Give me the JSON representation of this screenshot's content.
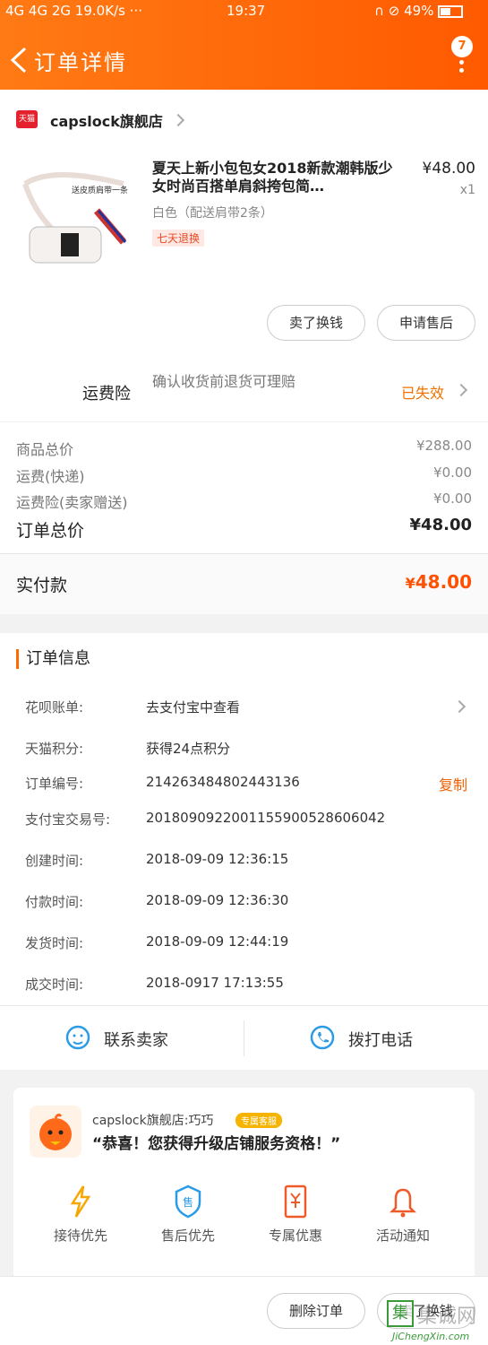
{
  "status_bar": {
    "left": "4G 4G 2G 19.0K/s ···",
    "time": "19:37",
    "battery": "49%"
  },
  "header": {
    "title": "订单详情",
    "badge": "7"
  },
  "shop": {
    "badge_text": "天猫",
    "name": "capslock旗舰店"
  },
  "product": {
    "title": "夏天上新小包包女2018新款潮韩版少女时尚百搭单肩斜挎包简…",
    "price": "¥48.00",
    "qty": "x1",
    "sku": "白色（配送肩带2条）",
    "tag": "七天退换",
    "image_caption": "送皮质肩带一条"
  },
  "actions": {
    "sell_btn": "卖了换钱",
    "after_sale_btn": "申请售后"
  },
  "insurance": {
    "label": "运费险",
    "text": "确认收货前退货可理赔",
    "status": "已失效"
  },
  "fees": [
    {
      "label": "商品总价",
      "value": "¥288.00"
    },
    {
      "label": "运费(快递)",
      "value": "¥0.00"
    },
    {
      "label": "运费险(卖家赠送)",
      "value": "¥0.00"
    }
  ],
  "total": {
    "label": "订单总价",
    "value": "¥48.00"
  },
  "paid": {
    "label": "实付款",
    "currency": "¥",
    "value": "48.00"
  },
  "order_info": {
    "title": "订单信息",
    "rows": [
      {
        "key": "花呗账单:",
        "value": "去支付宝中查看"
      },
      {
        "key": "天猫积分:",
        "value": "获得24点积分"
      },
      {
        "key": "订单编号:",
        "value": "214263484802443136"
      },
      {
        "key": "支付宝交易号:",
        "value": "2018090922001155900528606042"
      },
      {
        "key": "创建时间:",
        "value": "2018-09-09 12:36:15"
      },
      {
        "key": "付款时间:",
        "value": "2018-09-09 12:36:30"
      },
      {
        "key": "发货时间:",
        "value": "2018-09-09 12:44:19"
      },
      {
        "key": "成交时间:",
        "value": "2018-0917 17:13:55"
      }
    ],
    "copy": "复制"
  },
  "contact": {
    "seller": "联系卖家",
    "call": "拨打电话"
  },
  "vip": {
    "shop": "capslock旗舰店:巧巧",
    "tag": "专属客服",
    "message": "“恭喜！您获得升级店铺服务资格！”",
    "items": [
      {
        "label": "接待优先",
        "icon": "lightning-icon"
      },
      {
        "label": "售后优先",
        "icon": "shield-icon"
      },
      {
        "label": "专属优惠",
        "icon": "coupon-icon"
      },
      {
        "label": "活动通知",
        "icon": "bell-icon"
      }
    ]
  },
  "bottom": {
    "delete_btn": "删除订单",
    "sell_btn": "卖了换钱"
  },
  "watermark": {
    "main": "集诚网",
    "url": "JiChengXin.com"
  },
  "colors": {
    "brand": "#ff6a00",
    "price": "#ff5000",
    "status": "#f07000"
  }
}
